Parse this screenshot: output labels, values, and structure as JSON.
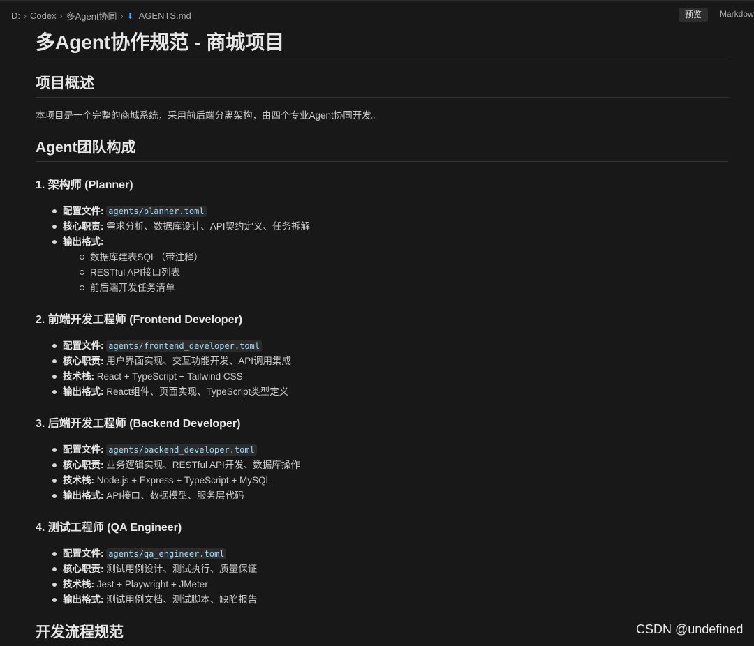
{
  "breadcrumb": {
    "items": [
      "D:",
      "Codex",
      "多Agent协同"
    ],
    "file": "AGENTS.md",
    "file_icon": "markdown-download-icon"
  },
  "tabs": {
    "preview": "预览",
    "markdown": "Markdow"
  },
  "doc": {
    "title": "多Agent协作规范 - 商城项目",
    "overview_heading": "项目概述",
    "overview_text": "本项目是一个完整的商城系统，采用前后端分离架构，由四个专业Agent协同开发。",
    "team_heading": "Agent团队构成",
    "agents": [
      {
        "heading": "1. 架构师 (Planner)",
        "config_label": "配置文件:",
        "config_value": "agents/planner.toml",
        "duty_label": "核心职责:",
        "duty_value": " 需求分析、数据库设计、API契约定义、任务拆解",
        "output_label": "输出格式:",
        "output_items": [
          "数据库建表SQL（带注释）",
          "RESTful API接口列表",
          "前后端开发任务清单"
        ]
      },
      {
        "heading": "2. 前端开发工程师 (Frontend Developer)",
        "config_label": "配置文件:",
        "config_value": "agents/frontend_developer.toml",
        "duty_label": "核心职责:",
        "duty_value": " 用户界面实现、交互功能开发、API调用集成",
        "stack_label": "技术栈:",
        "stack_value": " React + TypeScript + Tailwind CSS",
        "output_label": "输出格式:",
        "output_value": " React组件、页面实现、TypeScript类型定义"
      },
      {
        "heading": "3. 后端开发工程师 (Backend Developer)",
        "config_label": "配置文件:",
        "config_value": "agents/backend_developer.toml",
        "duty_label": "核心职责:",
        "duty_value": " 业务逻辑实现、RESTful API开发、数据库操作",
        "stack_label": "技术栈:",
        "stack_value": " Node.js + Express + TypeScript + MySQL",
        "output_label": "输出格式:",
        "output_value": " API接口、数据模型、服务层代码"
      },
      {
        "heading": "4. 测试工程师 (QA Engineer)",
        "config_label": "配置文件:",
        "config_value": "agents/qa_engineer.toml",
        "duty_label": "核心职责:",
        "duty_value": " 测试用例设计、测试执行、质量保证",
        "stack_label": "技术栈:",
        "stack_value": " Jest + Playwright + JMeter",
        "output_label": "输出格式:",
        "output_value": " 测试用例文档、测试脚本、缺陷报告"
      }
    ],
    "next_heading": "开发流程规范"
  },
  "watermark": "CSDN @undefined"
}
